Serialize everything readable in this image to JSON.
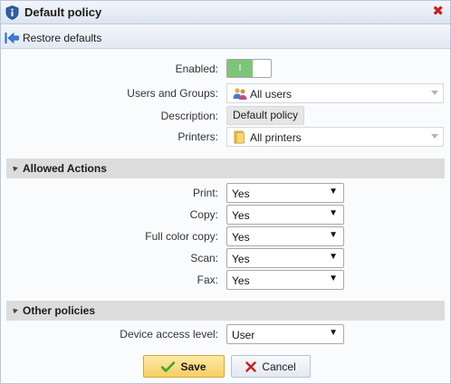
{
  "window": {
    "title": "Default policy"
  },
  "toolbar": {
    "restore_label": "Restore defaults"
  },
  "general": {
    "enabled_label": "Enabled:",
    "enabled_toggle_text": "I",
    "users_label": "Users and Groups:",
    "users_value": "All users",
    "description_label": "Description:",
    "description_value": "Default policy",
    "printers_label": "Printers:",
    "printers_value": "All printers"
  },
  "allowed_actions": {
    "title": "Allowed Actions",
    "rows": [
      {
        "label": "Print:",
        "value": "Yes"
      },
      {
        "label": "Copy:",
        "value": "Yes"
      },
      {
        "label": "Full color copy:",
        "value": "Yes"
      },
      {
        "label": "Scan:",
        "value": "Yes"
      },
      {
        "label": "Fax:",
        "value": "Yes"
      }
    ]
  },
  "other_policies": {
    "title": "Other policies",
    "device_access_label": "Device access level:",
    "device_access_value": "User"
  },
  "buttons": {
    "save_label": "Save",
    "cancel_label": "Cancel"
  },
  "icons": {
    "title": "shield-info-icon",
    "close": "close-x-icon",
    "restore": "arrow-left-to-bar-icon",
    "users": "users-group-icon",
    "printers": "folder-icon",
    "save": "checkmark-icon",
    "cancel": "cross-icon"
  },
  "colors": {
    "toggle_on": "#7ec47a",
    "close": "#c8201a",
    "save_button": "#f6cf63",
    "section_bg": "#dcdcdc"
  }
}
